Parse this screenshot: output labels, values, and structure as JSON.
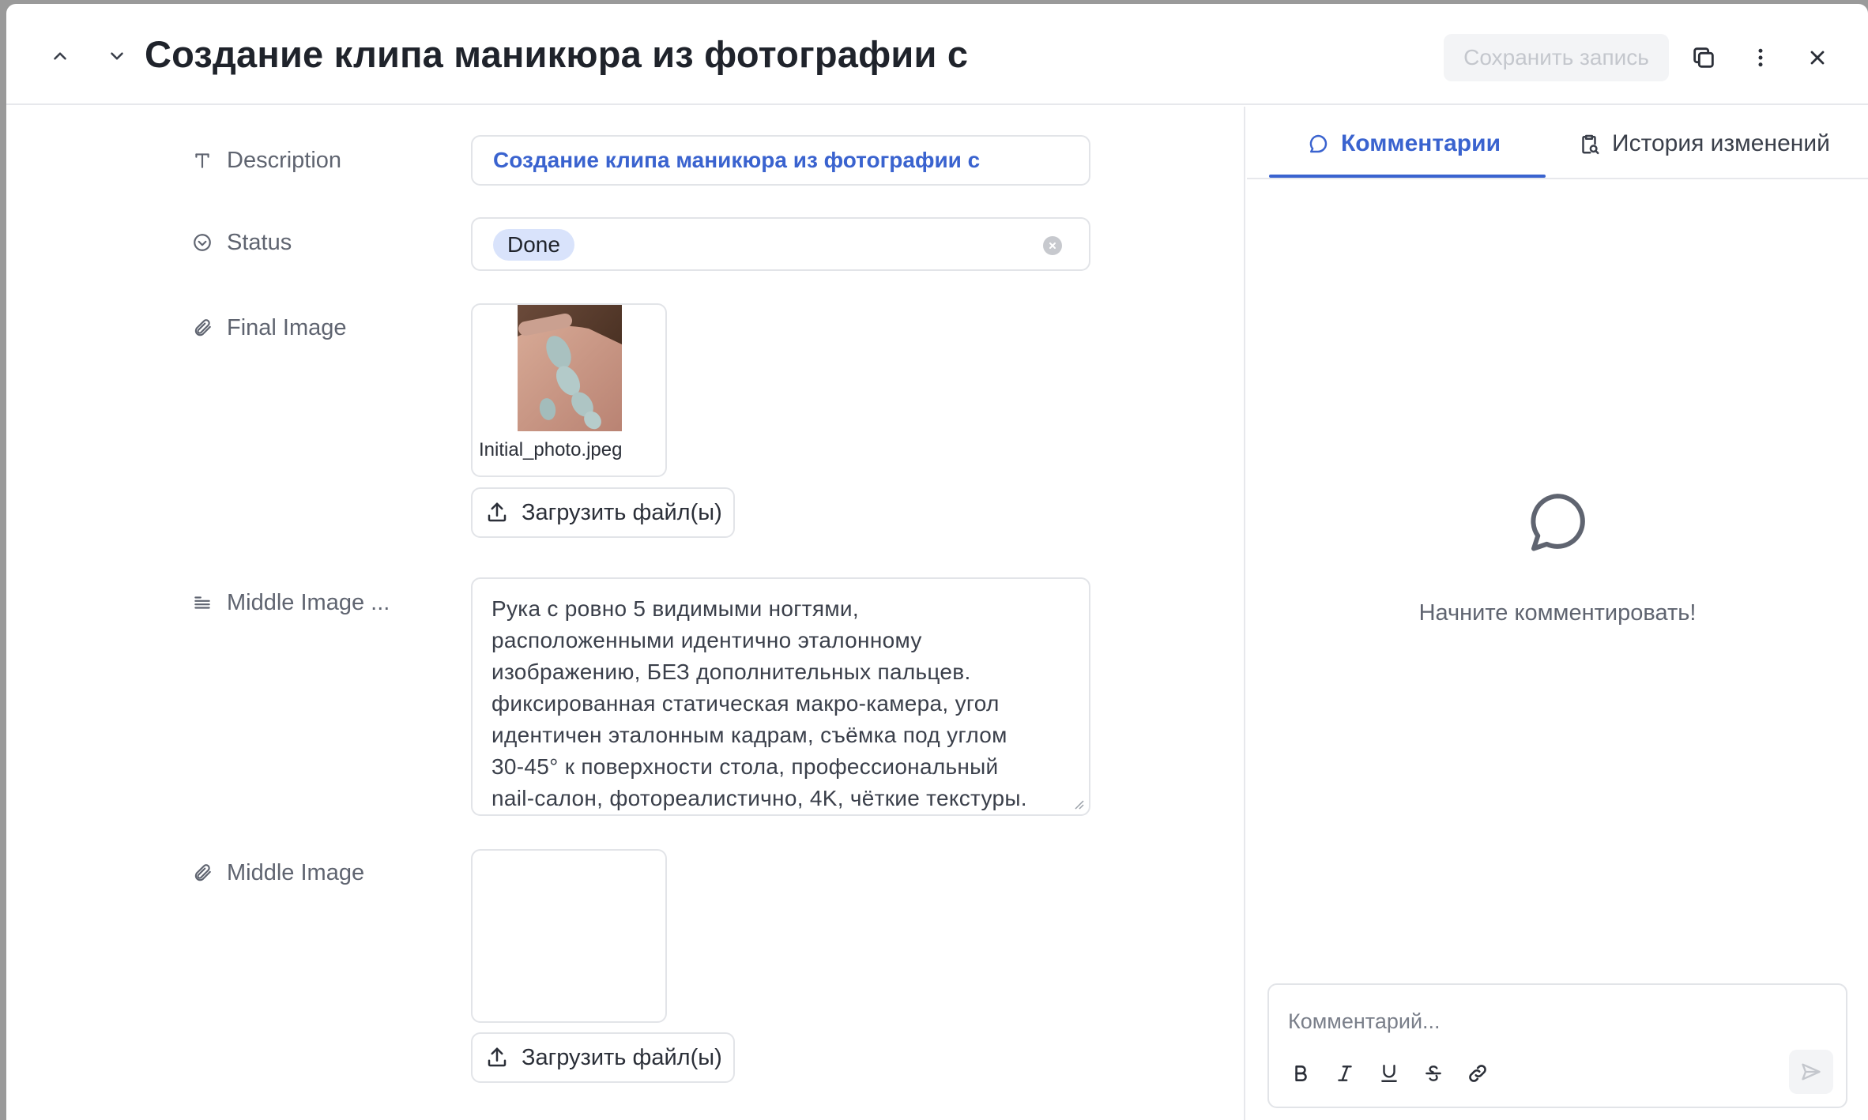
{
  "header": {
    "title": "Создание клипа маникюра из фотографии с",
    "save_label": "Сохранить запись",
    "icons": [
      "chevron-up-icon",
      "chevron-down-icon",
      "duplicate-icon",
      "more-vertical-icon",
      "close-icon"
    ]
  },
  "fields": {
    "description": {
      "label": "Description",
      "value": "Создание клипа маникюра из фотографии с"
    },
    "status": {
      "label": "Status",
      "value": "Done"
    },
    "final_image": {
      "label": "Final Image",
      "file_name": "Initial_photo.jpeg",
      "upload_label": "Загрузить файл(ы)"
    },
    "middle_image_prompt": {
      "label": "Middle Image ...",
      "value": "Рука с ровно 5 видимыми ногтями,\nрасположенными идентично эталонному\nизображению, БЕЗ дополнительных пальцев.\nфиксированная статическая макро-камера, угол\nидентичен эталонным кадрам, съёмка под углом\n30-45° к поверхности стола, профессиональный\nnail-салон, фотореалистично, 4K, чёткие текстуры."
    },
    "middle_image": {
      "label": "Middle Image",
      "upload_label": "Загрузить файл(ы)"
    }
  },
  "panel": {
    "tabs": [
      {
        "label": "Комментарии",
        "active": true
      },
      {
        "label": "История изменений",
        "active": false
      }
    ],
    "empty_text": "Начните комментировать!",
    "comment_placeholder": "Комментарий...",
    "format_icons": [
      "bold-icon",
      "italic-icon",
      "underline-icon",
      "strikethrough-icon",
      "link-icon"
    ]
  },
  "colors": {
    "accent": "#3a63cf",
    "chip_bg": "#d9e3fb",
    "border": "#e2e4e8",
    "label": "#5f6470"
  }
}
